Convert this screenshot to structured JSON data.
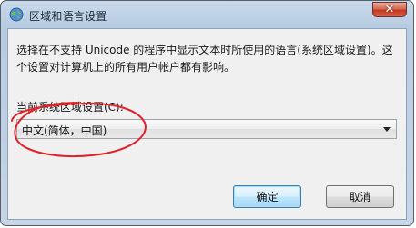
{
  "window": {
    "title": "区域和语言设置",
    "close_glyph": "✕",
    "icon": "region-globe-icon"
  },
  "content": {
    "description": "选择在不支持 Unicode 的程序中显示文本时所使用的语言(系统区域设置)。这个设置对计算机上的所有用户帐户都有影响。",
    "locale_label": "当前系统区域设置(C):",
    "locale_selected": "中文(简体，中国)"
  },
  "buttons": {
    "ok": "确定",
    "cancel": "取消"
  },
  "annotation": {
    "color": "#e0232a",
    "shape": "hand-drawn-circle"
  }
}
